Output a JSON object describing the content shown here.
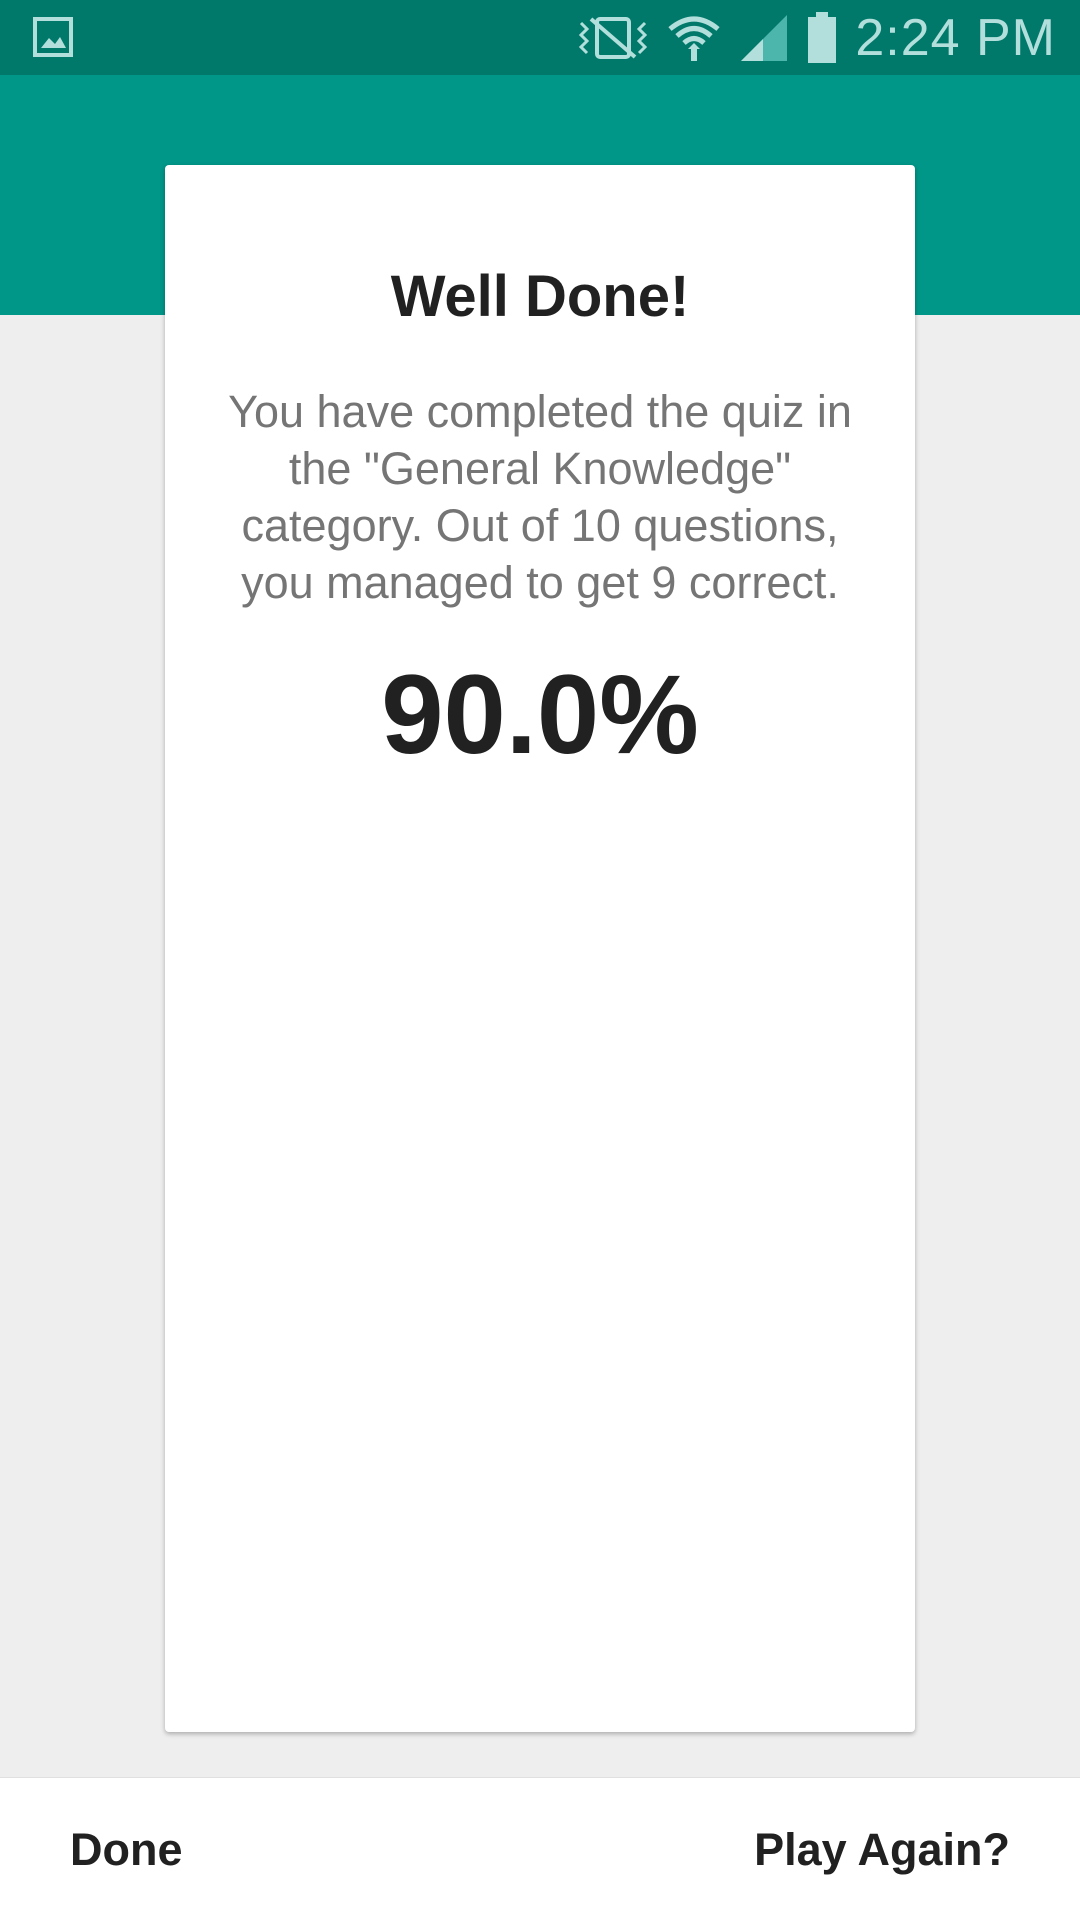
{
  "status_bar": {
    "time": "2:24 PM",
    "left_icon": "gallery-notification-icon",
    "icons": [
      "vibrate-icon",
      "wifi-icon",
      "signal-icon",
      "battery-icon"
    ],
    "bg_color": "#00796b"
  },
  "header": {
    "bg_color": "#009688"
  },
  "result_card": {
    "title": "Well Done!",
    "message": "You have completed the quiz in the \"General Knowledge\" category. Out of 10 questions, you managed to get 9 correct.",
    "score": "90.0%"
  },
  "actions": {
    "done_label": "Done",
    "play_again_label": "Play Again?"
  }
}
